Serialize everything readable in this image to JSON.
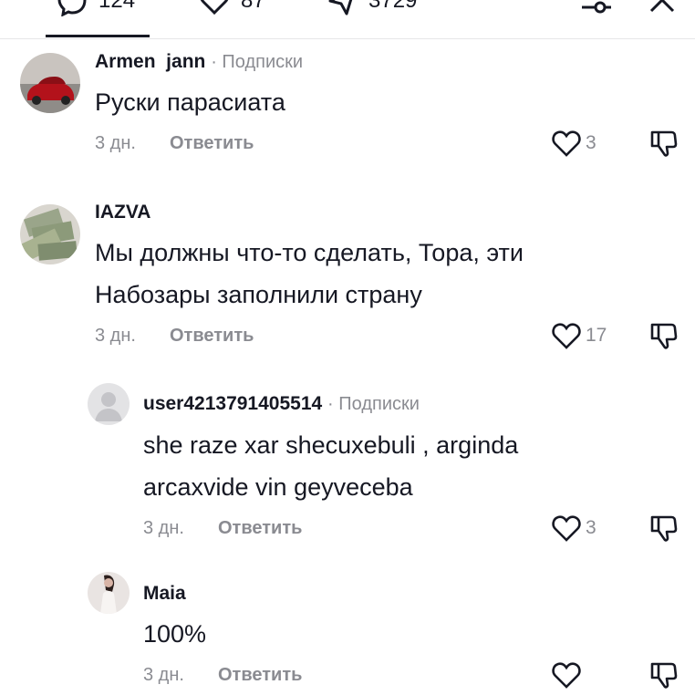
{
  "tabs": [
    {
      "icon": "comment-icon",
      "count": "124"
    },
    {
      "icon": "heart-icon",
      "count": "87"
    },
    {
      "icon": "share-icon",
      "count": "3729"
    }
  ],
  "toolbar": {
    "filter_icon": "filter-icon",
    "close_icon": "close-icon"
  },
  "comments": [
    {
      "username": "Armen  jann",
      "subtitle": "· Подписки",
      "text_lines": [
        "Руски парасиата"
      ],
      "date": "3 дн.",
      "reply_label": "Ответить",
      "likes": "3"
    },
    {
      "username": "IAZVA",
      "subtitle": "",
      "text_lines": [
        "Мы должны что-то сделать, Тора, эти",
        "Набозары заполнили страну"
      ],
      "date": "3 дн.",
      "reply_label": "Ответить",
      "likes": "17"
    },
    {
      "username": "user4213791405514",
      "subtitle": "· Подписки",
      "text_lines": [
        "she raze xar shecuxebuli , arginda",
        "arcaxvide vin geyveceba"
      ],
      "date": "3 дн.",
      "reply_label": "Ответить",
      "likes": "3"
    },
    {
      "username": "Maia",
      "subtitle": "",
      "text_lines": [
        "100%"
      ],
      "date": "3 дн.",
      "reply_label": "Ответить",
      "likes": ""
    }
  ],
  "colors": {
    "text": "#161823",
    "muted": "#8a8b91",
    "divider": "#e6e6e8"
  }
}
